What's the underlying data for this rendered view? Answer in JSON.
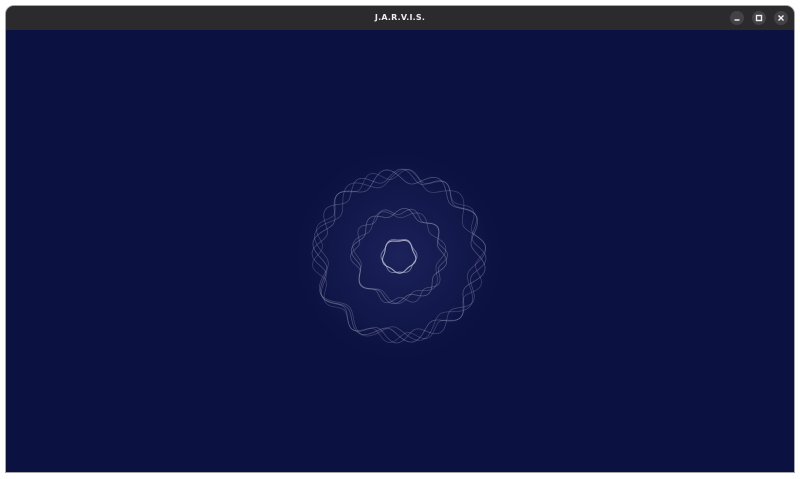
{
  "window": {
    "title": "J.A.R.V.I.S."
  },
  "titlebar_controls": [
    {
      "name": "minimize",
      "icon": "minimize-icon"
    },
    {
      "name": "maximize",
      "icon": "maximize-icon"
    },
    {
      "name": "close",
      "icon": "close-icon"
    }
  ],
  "visualizer": {
    "icon": "audio-orb-visualizer",
    "colors": {
      "background": "#0b1140",
      "ring_stroke": "#b9bcd2",
      "glow": "#2a3170"
    }
  }
}
